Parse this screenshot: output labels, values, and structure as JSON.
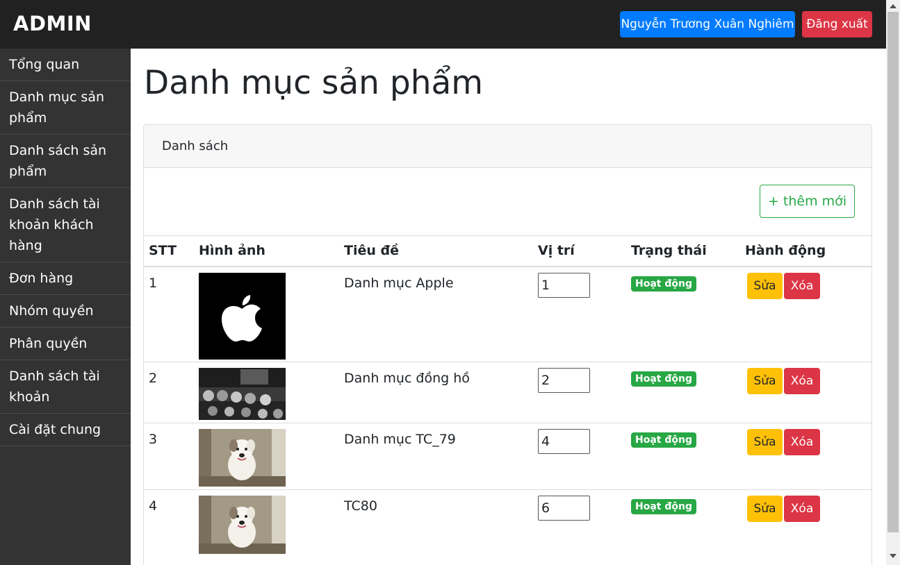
{
  "header": {
    "brand": "ADMIN",
    "user_name": "Nguyễn Trương Xuân Nghiêm",
    "logout_label": "Đăng xuất"
  },
  "sidebar": {
    "items": [
      {
        "label": "Tổng quan"
      },
      {
        "label": "Danh mục sản phẩm"
      },
      {
        "label": "Danh sách sản phẩm"
      },
      {
        "label": "Danh sách tài khoản khách hàng"
      },
      {
        "label": "Đơn hàng"
      },
      {
        "label": "Nhóm quyền"
      },
      {
        "label": "Phân quyền"
      },
      {
        "label": "Danh sách tài khoản"
      },
      {
        "label": "Cài đặt chung"
      }
    ]
  },
  "main": {
    "title": "Danh mục sản phẩm",
    "card_header": "Danh sách",
    "add_label": "+ thêm mới",
    "columns": [
      "STT",
      "Hình ảnh",
      "Tiêu đề",
      "Vị trí",
      "Trạng thái",
      "Hành động"
    ],
    "rows": [
      {
        "stt": "1",
        "title": "Danh mục Apple",
        "position": "1",
        "status": "Hoạt động",
        "edit": "Sửa",
        "delete": "Xóa"
      },
      {
        "stt": "2",
        "title": "Danh mục đồng hồ",
        "position": "2",
        "status": "Hoạt động",
        "edit": "Sửa",
        "delete": "Xóa"
      },
      {
        "stt": "3",
        "title": "Danh mục TC_79",
        "position": "4",
        "status": "Hoạt động",
        "edit": "Sửa",
        "delete": "Xóa"
      },
      {
        "stt": "4",
        "title": "TC80",
        "position": "6",
        "status": "Hoạt động",
        "edit": "Sửa",
        "delete": "Xóa"
      }
    ]
  },
  "colors": {
    "topbar": "#212121",
    "sidebar": "#333333",
    "primary": "#007bff",
    "danger": "#dc3545",
    "success": "#28a745",
    "warning": "#ffc107"
  }
}
